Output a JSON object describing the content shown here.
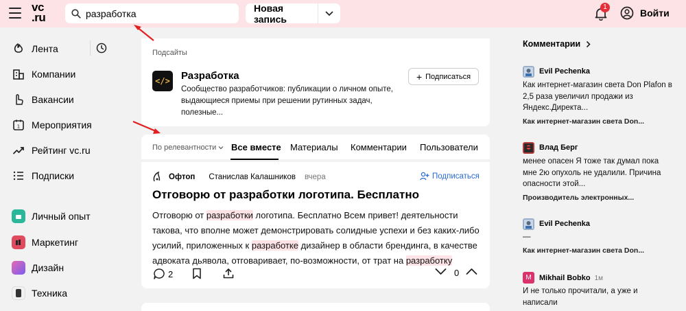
{
  "header": {
    "logo_line1": "vc",
    "logo_line2": ".ru",
    "search_value": "разработка",
    "new_post_label": "Новая запись",
    "notif_count": "1",
    "login_label": "Войти"
  },
  "sidebar": {
    "items": [
      {
        "label": "Лента",
        "icon": "feed-icon"
      },
      {
        "label": "Компании",
        "icon": "building-icon"
      },
      {
        "label": "Вакансии",
        "icon": "pointer-icon"
      },
      {
        "label": "Мероприятия",
        "icon": "calendar-icon"
      },
      {
        "label": "Рейтинг vc.ru",
        "icon": "trend-icon"
      },
      {
        "label": "Подписки",
        "icon": "list-icon"
      }
    ],
    "sections": [
      {
        "label": "Личный опыт",
        "color": "#2bb89a"
      },
      {
        "label": "Маркетинг",
        "color": "#e04a5f"
      },
      {
        "label": "Дизайн",
        "color": "#8a63e8"
      },
      {
        "label": "Техника",
        "color": "#333333"
      }
    ]
  },
  "subsites": {
    "label": "Подсайты",
    "logo_text": "</>",
    "title": "Разработка",
    "description": "Сообщество разработчиков: публикации о личном опыте, выдающиеся приемы при решении рутинных задач, полезные...",
    "subscribe_label": "Подписаться"
  },
  "tabs": {
    "sort_label": "По релевантности",
    "items": [
      "Все вместе",
      "Материалы",
      "Комментарии",
      "Пользователи"
    ]
  },
  "post": {
    "category": "Офтоп",
    "author": "Станислав Калашников",
    "time": "вчера",
    "subscribe_label": "Подписаться",
    "title": "Отговорю от разработки логотипа. Бесплатно",
    "body": [
      "Отговорю от ",
      "разработки",
      " логотипа. Бесплатно Всем привет! деятельности такова, что вполне может демонстрировать солидные успехи и без каких-либо усилий, приложенных к ",
      "разработке",
      " дизайнер в области брендинга, в качестве адвоката дьявола, отговаривает, по-возможности, от трат на ",
      "разработку"
    ],
    "comments": "2",
    "rating": "0"
  },
  "comments": {
    "title": "Комментарии",
    "items": [
      {
        "name": "Evil Pechenka",
        "time": "",
        "text": "Как интернет-магазин света Don Plafon в 2,5 раза увеличил продажи из Яндекс.Директа...",
        "source": "Как интернет-магазин света Don...",
        "color": "#9ab0c8"
      },
      {
        "name": "Влад Берг",
        "time": "",
        "text": "менее опасен Я тоже так думал пока мне 2ю опухоль не удалили. Причина опасности этой...",
        "source": "Производитель электронных...",
        "color": "#b53a3a"
      },
      {
        "name": "Evil Pechenka",
        "time": "",
        "text": "—",
        "source": "Как интернет-магазин света Don...",
        "color": "#9ab0c8"
      },
      {
        "name": "Mikhail Bobko",
        "time": "1м",
        "text": "И не только прочитали, а уже и написали",
        "source": "",
        "color": "#d9326c"
      }
    ]
  }
}
